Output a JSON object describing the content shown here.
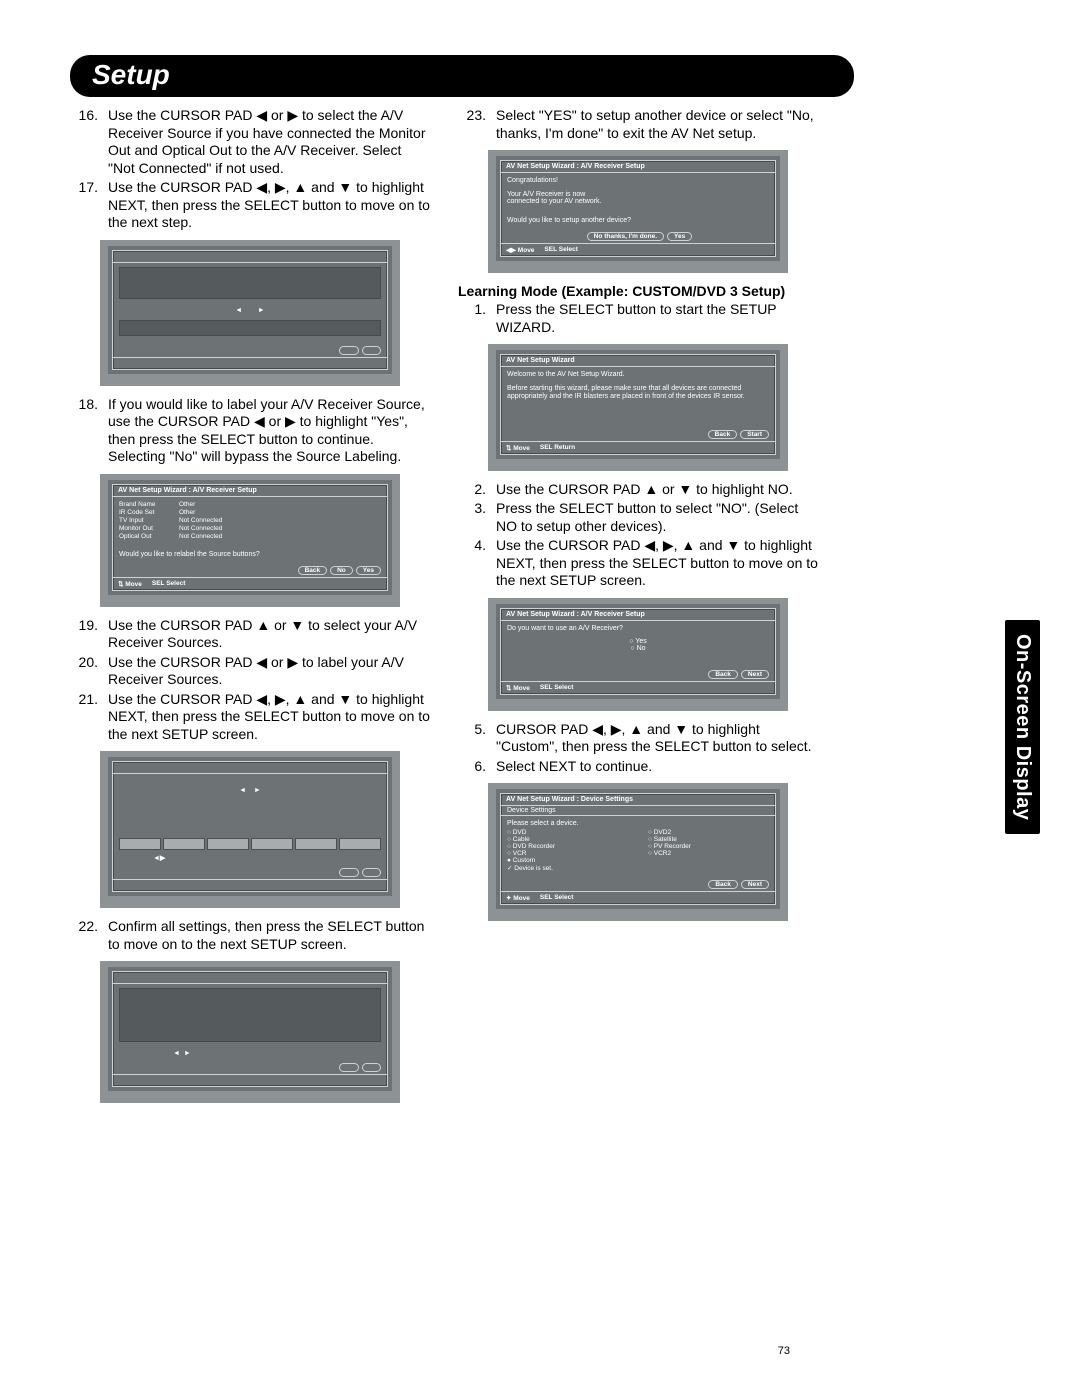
{
  "header": "Setup",
  "side_tab": "On-Screen Display",
  "page_number": "73",
  "leftSteps": [
    {
      "n": "16.",
      "t": "Use the CURSOR PAD ◀ or ▶ to select the A/V Receiver Source if you have connected the Monitor Out and Optical Out to the A/V Receiver.  Select \"Not Connected\" if not used."
    },
    {
      "n": "17.",
      "t": "Use the CURSOR PAD ◀, ▶, ▲ and ▼ to highlight NEXT, then press the SELECT button to move on to the next step."
    }
  ],
  "leftSteps2": [
    {
      "n": "18.",
      "t": "If you would like to label your A/V Receiver Source, use the CURSOR PAD ◀ or ▶ to highlight \"Yes\", then press the SELECT button to continue.  Selecting \"No\" will bypass the Source Labeling."
    }
  ],
  "leftSteps3": [
    {
      "n": "19.",
      "t": "Use the CURSOR PAD ▲ or ▼ to select your A/V Receiver Sources."
    },
    {
      "n": "20.",
      "t": "Use the CURSOR PAD ◀ or ▶ to label your A/V Receiver Sources."
    },
    {
      "n": "21.",
      "t": "Use the CURSOR PAD ◀, ▶, ▲ and ▼ to highlight NEXT, then press the SELECT button to move on to the next SETUP screen."
    }
  ],
  "leftSteps4": [
    {
      "n": "22.",
      "t": "Confirm all settings, then press the SELECT button to move on to the next SETUP screen."
    }
  ],
  "rightSteps1": [
    {
      "n": "23.",
      "t": "Select \"YES\" to setup another device or select \"No, thanks, I'm done\" to exit the AV Net setup."
    }
  ],
  "subheading": "Learning Mode (Example:  CUSTOM/DVD 3 Setup)",
  "rightSteps2": [
    {
      "n": "1.",
      "t": "Press the SELECT button to start the SETUP WIZARD."
    }
  ],
  "rightSteps3": [
    {
      "n": "2.",
      "t": "Use the CURSOR PAD ▲ or ▼ to highlight NO."
    },
    {
      "n": "3.",
      "t": "Press the SELECT button to select \"NO\". (Select NO to setup other devices)."
    },
    {
      "n": "4.",
      "t": "Use the CURSOR PAD ◀, ▶, ▲ and ▼ to highlight NEXT, then press the SELECT button to move on to the next SETUP screen."
    }
  ],
  "rightSteps4": [
    {
      "n": "5.",
      "t": "CURSOR PAD ◀, ▶, ▲ and ▼ to highlight \"Custom\", then press the SELECT button to select."
    },
    {
      "n": "6.",
      "t": "Select NEXT to continue."
    }
  ],
  "tv2": {
    "title": "AV Net Setup Wizard : A/V Receiver Setup",
    "rows": [
      {
        "k": "Brand Name",
        "v": "Other"
      },
      {
        "k": "IR Code Set",
        "v": "Other"
      },
      {
        "k": "TV Input",
        "v": "Not Connected"
      },
      {
        "k": "Monitor Out",
        "v": "Not Connected"
      },
      {
        "k": "Optical Out",
        "v": "Not Connected"
      }
    ],
    "question": "Would you like to relabel the Source buttons?",
    "btns": [
      "Back",
      "No",
      "Yes"
    ],
    "footer": [
      "⇅ Move",
      "SEL Select"
    ]
  },
  "tv5": {
    "title": "AV Net Setup Wizard : A/V Receiver Setup",
    "line1": "Congratulations!",
    "line2": "Your A/V Receiver is now",
    "line3": "connected to your AV network.",
    "question": "Would you like to setup another device?",
    "btns": [
      "No thanks, I'm done.",
      "Yes"
    ],
    "footer": [
      "◀▶ Move",
      "SEL Select"
    ]
  },
  "tv6": {
    "title": "AV Net Setup Wizard",
    "line1": "Welcome to the AV Net Setup Wizard.",
    "line2": "Before starting this wizard, please make sure that all devices are connected appropriately and the IR blasters are placed in front of the devices IR sensor.",
    "btns": [
      "Back",
      "Start"
    ],
    "footer": [
      "⇅ Move",
      "SEL Return"
    ]
  },
  "tv7": {
    "title": "AV Net Setup Wizard : A/V Receiver Setup",
    "question": "Do you want to use an A/V Receiver?",
    "opts": [
      "Yes",
      "No"
    ],
    "btns": [
      "Back",
      "Next"
    ],
    "footer": [
      "⇅ Move",
      "SEL Select"
    ]
  },
  "tv8": {
    "title": "AV Net Setup Wizard : Device Settings",
    "sub": "Device Settings",
    "prompt": "Please select a device.",
    "col1": [
      "DVD",
      "Cable",
      "DVD Recorder",
      "VCR",
      "Custom",
      "Device is set."
    ],
    "col2": [
      "DVD2",
      "Satellite",
      "PV Recorder",
      "VCR2"
    ],
    "btns": [
      "Back",
      "Next"
    ],
    "footer": [
      "✦ Move",
      "SEL Select"
    ]
  }
}
